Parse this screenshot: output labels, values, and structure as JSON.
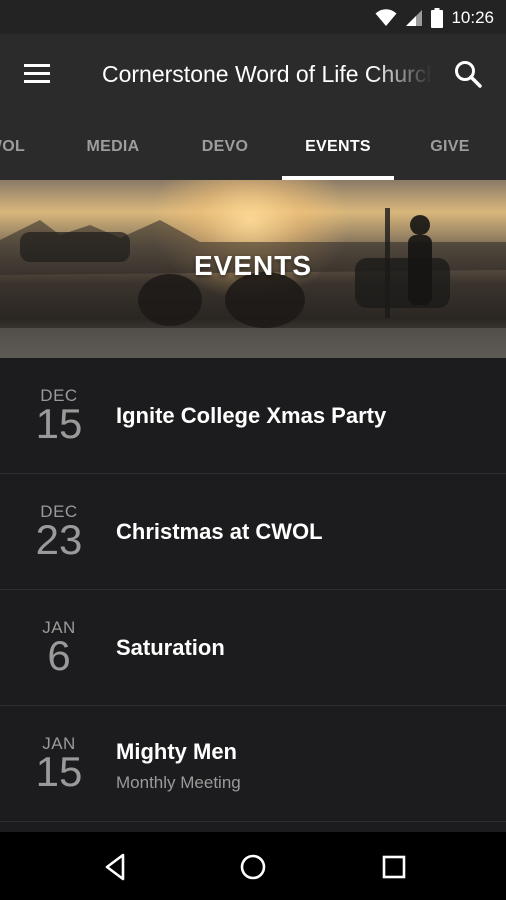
{
  "status_bar": {
    "time": "10:26"
  },
  "app_bar": {
    "title": "Cornerstone Word of Life Church"
  },
  "tabs": [
    {
      "label": "CWOL",
      "active": false
    },
    {
      "label": "MEDIA",
      "active": false
    },
    {
      "label": "DEVO",
      "active": false
    },
    {
      "label": "EVENTS",
      "active": true
    },
    {
      "label": "GIVE",
      "active": false
    }
  ],
  "hero": {
    "title": "EVENTS"
  },
  "events": [
    {
      "month": "DEC",
      "day": "15",
      "title": "Ignite College Xmas Party",
      "subtitle": ""
    },
    {
      "month": "DEC",
      "day": "23",
      "title": "Christmas at CWOL",
      "subtitle": ""
    },
    {
      "month": "JAN",
      "day": "6",
      "title": "Saturation",
      "subtitle": ""
    },
    {
      "month": "JAN",
      "day": "15",
      "title": "Mighty Men",
      "subtitle": "Monthly Meeting"
    }
  ],
  "colors": {
    "app_bar": "#2b2b2b",
    "list_bg": "#1c1c1e",
    "muted_text": "#9a9a9a"
  }
}
